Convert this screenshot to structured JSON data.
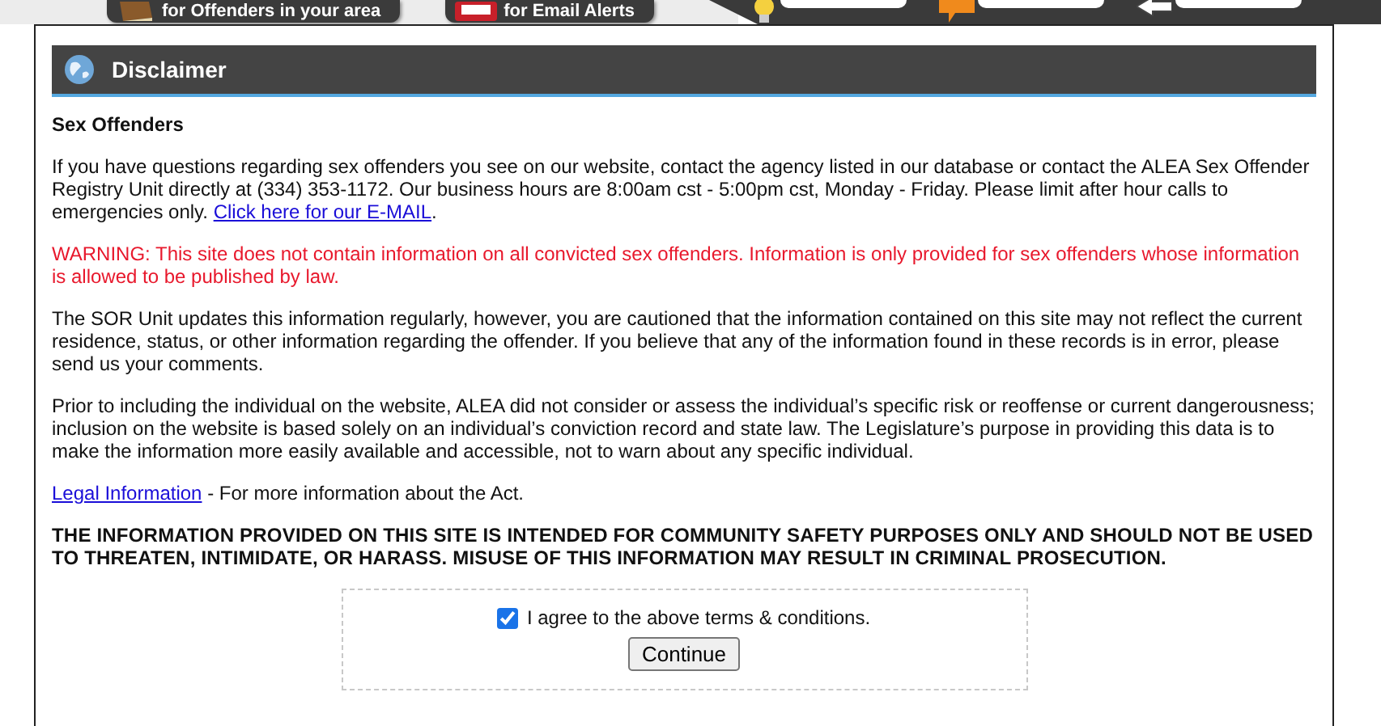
{
  "top_banner": {
    "buttons": [
      {
        "label": "for Offenders in your area"
      },
      {
        "label": "for Email Alerts"
      }
    ]
  },
  "panel": {
    "title": "Disclaimer",
    "heading": "Sex Offenders",
    "paragraphs": [
      {
        "kind": "normal",
        "text": "If you have questions regarding sex offenders you see on our website, contact the agency listed in our database or contact the ALEA Sex Offender Registry Unit directly at (334) 353-1172. Our business hours are 8:00am cst - 5:00pm cst, Monday - Friday. Please limit after hour calls to emergencies only. ",
        "link": "Click here for our E-MAIL",
        "after": "."
      },
      {
        "kind": "warning",
        "text": "WARNING: This site does not contain information on all convicted sex offenders. Information is only provided for sex offenders whose information is allowed to be published by law."
      },
      {
        "kind": "normal",
        "text": "The SOR Unit updates this information regularly, however, you are cautioned that the information contained on this site may not reflect the current residence, status, or other information regarding the offender. If you believe that any of the information found in these records is in error, please send us your comments."
      },
      {
        "kind": "normal",
        "text": "Prior to including the individual on the website, ALEA did not consider or assess the individual’s specific risk or reoffense or current dangerousness; inclusion on the website is based solely on an individual’s conviction record and state law. The Legislature’s purpose in providing this data is to make the information more easily available and accessible, not to warn about any specific individual."
      },
      {
        "kind": "link_first",
        "link": "Legal Information",
        "text": " - For more information about the Act."
      },
      {
        "kind": "notice",
        "text": "THE INFORMATION PROVIDED ON THIS SITE IS INTENDED FOR COMMUNITY SAFETY PURPOSES ONLY AND SHOULD NOT BE USED TO THREATEN, INTIMIDATE, OR HARASS. MISUSE OF THIS INFORMATION MAY RESULT IN CRIMINAL PROSECUTION."
      }
    ],
    "agreement": {
      "label": "I agree to the above terms & conditions.",
      "checked": true
    },
    "button": "Continue"
  }
}
